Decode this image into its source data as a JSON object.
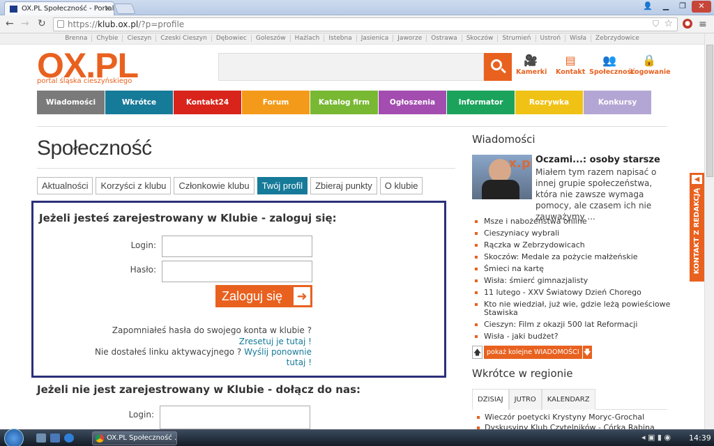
{
  "browser": {
    "tab_title": "OX.PL Społeczność - Portal",
    "url_scheme": "https://",
    "url_host": "klub.ox.pl",
    "url_path": "/?p=profile"
  },
  "townbar": [
    "Brenna",
    "Chybie",
    "Cieszyn",
    "Czeski Cieszyn",
    "Dębowiec",
    "Goleszów",
    "Hażlach",
    "Istebna",
    "Jasienica",
    "Jaworze",
    "Ostrawa",
    "Skoczów",
    "Strumień",
    "Ustroń",
    "Wisła",
    "Zebrzydowice"
  ],
  "header": {
    "logo": "OX.PL",
    "logo_sub": "portal śląska cieszyńskiego",
    "links": {
      "kamerki": "Kamerki",
      "kontakt": "Kontakt",
      "spolecznosc": "Społeczność",
      "logowanie": "Logowanie"
    }
  },
  "mainmenu": [
    {
      "label": "Wiadomości",
      "color": "#7a7a7a",
      "w": 97
    },
    {
      "label": "Wkrótce",
      "color": "#167a99",
      "w": 97
    },
    {
      "label": "Kontakt24",
      "color": "#d9241c",
      "w": 97
    },
    {
      "label": "Forum",
      "color": "#f49a1a",
      "w": 97
    },
    {
      "label": "Katalog firm",
      "color": "#78b833",
      "w": 97
    },
    {
      "label": "Ogłoszenia",
      "color": "#a34db0",
      "w": 97
    },
    {
      "label": "Informator",
      "color": "#1ba35c",
      "w": 97
    },
    {
      "label": "Rozrywka",
      "color": "#f1c216",
      "w": 97
    },
    {
      "label": "Konkursy",
      "color": "#b4a6d4",
      "w": 97
    }
  ],
  "page": {
    "title": "Społeczność",
    "tabs": [
      "Aktualności",
      "Korzyści z klubu",
      "Członkowie klubu",
      "Twój profil",
      "Zbieraj punkty",
      "O klubie"
    ],
    "active_tab": 3
  },
  "login": {
    "heading": "Jeżeli jesteś zarejestrowany w Klubie - zaloguj się:",
    "login_label": "Login:",
    "password_label": "Hasło:",
    "login_value": "",
    "password_value": "",
    "submit": "Zaloguj się",
    "forgot": "Zapomniałeś hasła do swojego konta w klubie ?",
    "reset_link": "Zresetuj je tutaj !",
    "no_link": "Nie dostałeś linku aktywacyjnego ?",
    "resend_link1": "Wyślij ponownie",
    "resend_link2": "tutaj !"
  },
  "join": {
    "heading": "Jeżeli nie jest zarejestrowany w Klubie - dołącz do nas:",
    "login_label": "Login:"
  },
  "sidebar": {
    "news_title": "Wiadomości",
    "featured_title": "Oczami...: osoby starsze",
    "featured_text": "Miałem tym razem napisać o innej grupie społeczeństwa, która nie zawsze wymaga pomocy, ale czasem ich nie zauważymy ...",
    "news": [
      "Msze i nabożeństwa online",
      "Cieszyniacy wybrali",
      "Rączka w Zebrzydowicach",
      "Skoczów: Medale za pożycie małżeńskie",
      "Śmieci na kartę",
      "Wisła: śmierć gimnazjalisty",
      "11 lutego - XXV Światowy Dzień Chorego",
      "Kto nie wiedział, już wie, gdzie leżą powieściowe Stawiska",
      "Cieszyn: Film z okazji 500 lat Reformacji",
      "Wisła - jaki budżet?"
    ],
    "more_label": "pokaż kolejne WIADOMOŚCI",
    "region_title": "Wkrótce w regionie",
    "region_tabs": [
      "DZISIAJ",
      "JUTRO",
      "KALENDARZ"
    ],
    "region_items": [
      "Wieczór poetycki Krystyny Moryc-Grochal",
      "Dyskusyjny Klub Czytelników - Córka Rabina"
    ],
    "side_tab": "KONTAKT Z REDAKCJĄ"
  },
  "taskbar": {
    "window": "OX.PL Społeczność ...",
    "clock": "14:39"
  }
}
